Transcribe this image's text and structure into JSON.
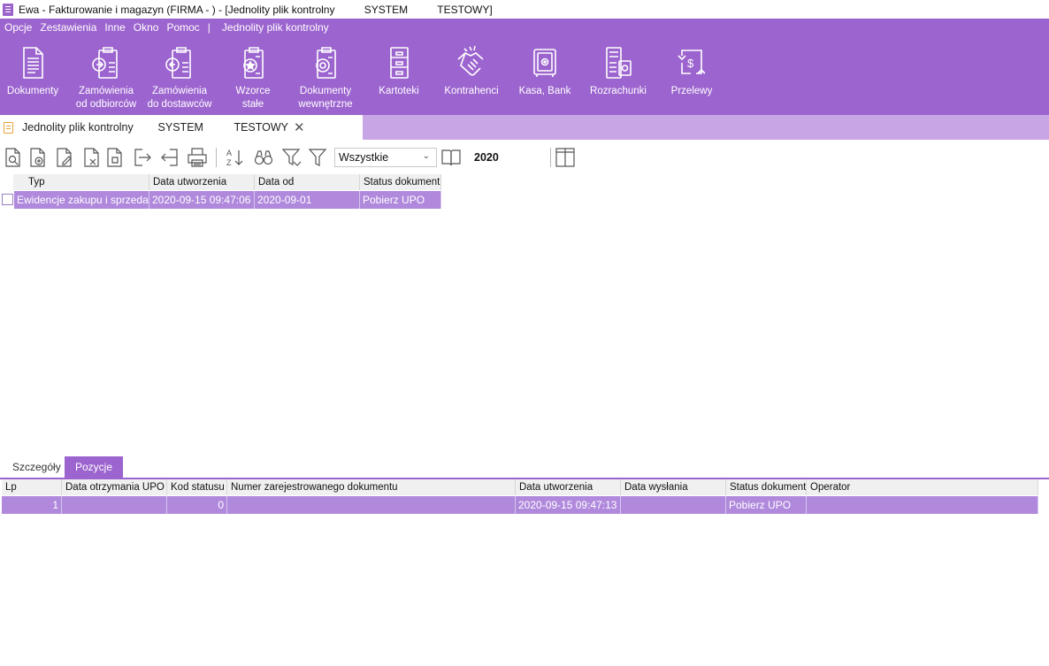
{
  "window": {
    "title": "Ewa - Fakturowanie i magazyn (FIRMA - ) - [Jednolity plik kontrolny          SYSTEM          TESTOWY]"
  },
  "menu": {
    "items": [
      {
        "label": "Opcje",
        "icon": "none"
      },
      {
        "label": "Zestawienia"
      },
      {
        "label": "Inne"
      },
      {
        "label": "Okno"
      },
      {
        "label": "Pomoc"
      }
    ],
    "separator": "|",
    "jpk_label": "Jednolity plik kontrolny"
  },
  "ribbon": {
    "buttons": [
      {
        "label": "Dokumenty",
        "icon": "document-icon"
      },
      {
        "label": "Zamówienia\nod odbiorców",
        "icon": "order-in-icon"
      },
      {
        "label": "Zamówienia\ndo dostawców",
        "icon": "order-out-icon"
      },
      {
        "label": "Wzorce\nstałe",
        "icon": "template-icon"
      },
      {
        "label": "Dokumenty\nwewnętrzne",
        "icon": "internal-document-icon"
      },
      {
        "label": "Kartoteki",
        "icon": "cabinet-icon"
      },
      {
        "label": "Kontrahenci",
        "icon": "handshake-icon"
      },
      {
        "label": "Kasa, Bank",
        "icon": "safe-icon"
      },
      {
        "label": "Rozrachunki",
        "icon": "settlements-icon"
      },
      {
        "label": "Przelewy",
        "icon": "transfer-icon"
      }
    ]
  },
  "doc_tab": {
    "label": "Jednolity plik kontrolny        SYSTEM          TESTOWY",
    "close": "✕"
  },
  "toolbar": {
    "filter_value": "Wszystkie",
    "year": "2020"
  },
  "upper_grid": {
    "columns": [
      "Typ",
      "Data utworzenia",
      "Data od",
      "Status dokumentu"
    ],
    "rows": [
      [
        "Ewidencje zakupu i sprzedaży",
        "2020-09-15 09:47:06",
        "2020-09-01",
        "Pobierz UPO"
      ]
    ]
  },
  "bottom_tabs": [
    "Szczegóły",
    "Pozycje"
  ],
  "lower_grid": {
    "columns": [
      "Lp",
      "Data otrzymania UPO",
      "Kod statusu",
      "Numer zarejestrowanego dokumentu",
      "Data utworzenia",
      "Data wysłania",
      "Status dokumentu",
      "Operator"
    ],
    "rows": [
      [
        "1",
        "",
        "0",
        "",
        "2020-09-15 09:47:13",
        "",
        "Pobierz UPO",
        ""
      ]
    ]
  },
  "colors": {
    "accent": "#9c64cf",
    "row_selected": "#b089dc",
    "tab_strip": "#c8a6e6"
  }
}
